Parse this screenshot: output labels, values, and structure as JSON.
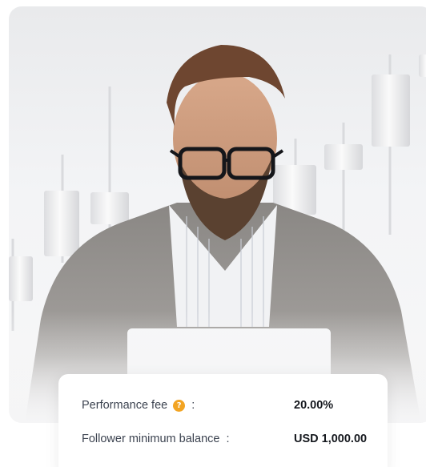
{
  "hero": {
    "image_subject": "man-with-glasses-using-laptop",
    "background_color": "#eeeff1"
  },
  "info": {
    "rows": [
      {
        "label": "Performance fee",
        "has_help_icon": true,
        "separator": ":",
        "value": "20.00%"
      },
      {
        "label": "Follower minimum balance",
        "has_help_icon": false,
        "separator": ":",
        "value": "USD 1,000.00"
      }
    ],
    "help_icon_glyph": "?",
    "help_icon_color": "#f2a423"
  }
}
